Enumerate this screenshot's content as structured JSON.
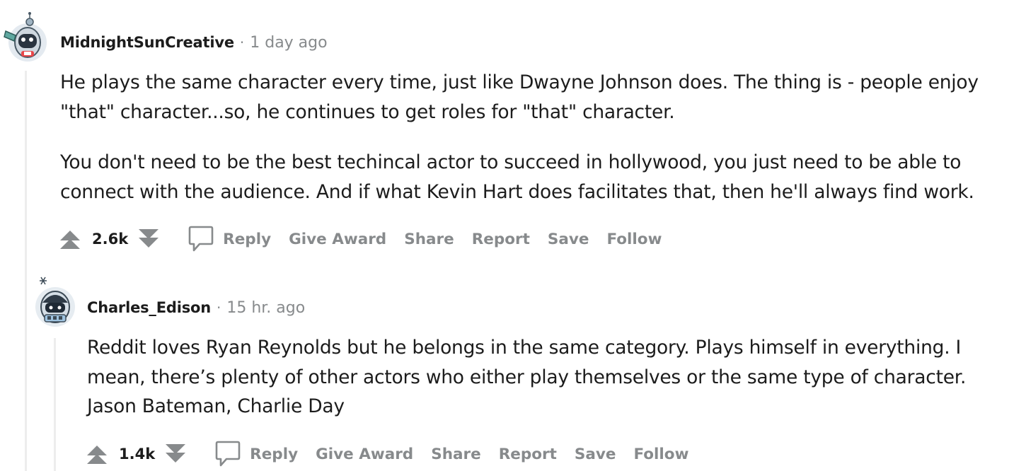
{
  "comments": [
    {
      "author": "MidnightSunCreative",
      "separator": "·",
      "time": "1 day ago",
      "paragraphs": [
        [
          "He plays the same character every time, just like Dwayne Johnson does. The thing is - people enjoy",
          "\"that\" character...so, he continues to get roles for \"that\" character."
        ],
        [
          "You don't need to be the best techincal actor to succeed in hollywood, you just need to be able to",
          "connect with the audience. And if what Kevin Hart does facilitates that, then he'll always find work."
        ]
      ],
      "score": "2.6k",
      "actions": {
        "reply": "Reply",
        "give_award": "Give Award",
        "share": "Share",
        "report": "Report",
        "save": "Save",
        "follow": "Follow"
      }
    },
    {
      "author": "Charles_Edison",
      "separator": "·",
      "time": "15 hr. ago",
      "paragraphs": [
        [
          "Reddit loves Ryan Reynolds but he belongs in the same category. Plays himself in everything. I",
          "mean, there’s plenty of other actors who either play themselves or the same type of character.",
          "Jason Bateman, Charlie Day"
        ]
      ],
      "score": "1.4k",
      "actions": {
        "reply": "Reply",
        "give_award": "Give Award",
        "share": "Share",
        "report": "Report",
        "save": "Save",
        "follow": "Follow"
      }
    }
  ],
  "icons": {
    "upvote": "upvote-icon",
    "downvote": "downvote-icon",
    "reply": "comment-bubble-icon",
    "avatar": "snoo-avatar-icon"
  },
  "colors": {
    "text": "#1c1c1c",
    "muted": "#878a8c",
    "thread_line": "#ededed"
  }
}
